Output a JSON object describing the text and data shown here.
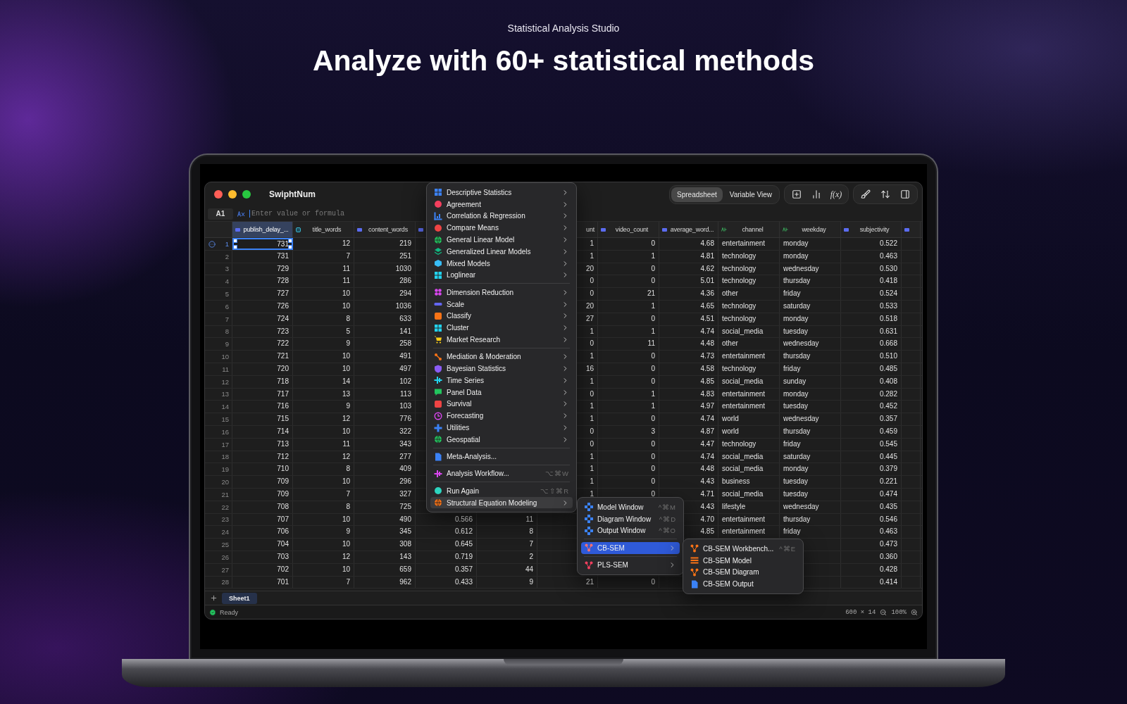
{
  "page": {
    "subtitle": "Statistical Analysis Studio",
    "headline": "Analyze with 60+ statistical methods"
  },
  "window": {
    "title": "SwiphtNum"
  },
  "view_switch": [
    {
      "label": "Spreadsheet",
      "selected": true
    },
    {
      "label": "Variable View",
      "selected": false
    }
  ],
  "toolbar": {
    "formula_button": "f(x)"
  },
  "formula_bar": {
    "cell_ref": "A1",
    "placeholder": "Enter value or formula"
  },
  "columns": [
    {
      "label": "publish_delay_...",
      "kind": "scale",
      "selected": true
    },
    {
      "label": "title_words",
      "kind": "ordinal",
      "selected": false
    },
    {
      "label": "content_words",
      "kind": "scale",
      "selected": false
    },
    {
      "kind": "scale",
      "selected": false
    },
    {},
    {
      "label": "unt",
      "clipped": true,
      "selected": false
    },
    {
      "label": "video_count",
      "kind": "scale",
      "selected": false
    },
    {
      "label": "average_word...",
      "kind": "scale",
      "selected": false
    },
    {
      "label": "channel",
      "kind": "nominal",
      "selected": false
    },
    {
      "label": "weekday",
      "kind": "nominal",
      "selected": false
    },
    {
      "label": "subjectivity",
      "kind": "scale",
      "selected": false
    },
    {
      "kind": "scale",
      "selected": false
    }
  ],
  "rows": [
    {
      "number": "1",
      "selected": true,
      "cells": [
        "731",
        "12",
        "219",
        null,
        null,
        "1",
        "0",
        "4.68",
        "entertainment",
        "monday",
        "0.522",
        null
      ]
    },
    {
      "number": "2",
      "selected": false,
      "cells": [
        "731",
        "7",
        "251",
        null,
        null,
        "1",
        "1",
        "4.81",
        "technology",
        "monday",
        "0.463",
        null
      ]
    },
    {
      "number": "3",
      "selected": false,
      "cells": [
        "729",
        "11",
        "1030",
        null,
        null,
        "20",
        "0",
        "4.62",
        "technology",
        "wednesday",
        "0.530",
        null
      ]
    },
    {
      "number": "4",
      "selected": false,
      "cells": [
        "728",
        "11",
        "286",
        null,
        null,
        "0",
        "0",
        "5.01",
        "technology",
        "thursday",
        "0.418",
        null
      ]
    },
    {
      "number": "5",
      "selected": false,
      "cells": [
        "727",
        "10",
        "294",
        null,
        null,
        "0",
        "21",
        "4.36",
        "other",
        "friday",
        "0.524",
        null
      ]
    },
    {
      "number": "6",
      "selected": false,
      "cells": [
        "726",
        "10",
        "1036",
        null,
        null,
        "20",
        "1",
        "4.65",
        "technology",
        "saturday",
        "0.533",
        null
      ]
    },
    {
      "number": "7",
      "selected": false,
      "cells": [
        "724",
        "8",
        "633",
        null,
        null,
        "27",
        "0",
        "4.51",
        "technology",
        "monday",
        "0.518",
        null
      ]
    },
    {
      "number": "8",
      "selected": false,
      "cells": [
        "723",
        "5",
        "141",
        null,
        null,
        "1",
        "1",
        "4.74",
        "social_media",
        "tuesday",
        "0.631",
        null
      ]
    },
    {
      "number": "9",
      "selected": false,
      "cells": [
        "722",
        "9",
        "258",
        null,
        null,
        "0",
        "11",
        "4.48",
        "other",
        "wednesday",
        "0.668",
        null
      ]
    },
    {
      "number": "10",
      "selected": false,
      "cells": [
        "721",
        "10",
        "491",
        null,
        null,
        "1",
        "0",
        "4.73",
        "entertainment",
        "thursday",
        "0.510",
        null
      ]
    },
    {
      "number": "11",
      "selected": false,
      "cells": [
        "720",
        "10",
        "497",
        null,
        null,
        "16",
        "0",
        "4.58",
        "technology",
        "friday",
        "0.485",
        null
      ]
    },
    {
      "number": "12",
      "selected": false,
      "cells": [
        "718",
        "14",
        "102",
        null,
        null,
        "1",
        "0",
        "4.85",
        "social_media",
        "sunday",
        "0.408",
        null
      ]
    },
    {
      "number": "13",
      "selected": false,
      "cells": [
        "717",
        "13",
        "113",
        null,
        null,
        "0",
        "1",
        "4.83",
        "entertainment",
        "monday",
        "0.282",
        null
      ]
    },
    {
      "number": "14",
      "selected": false,
      "cells": [
        "716",
        "9",
        "103",
        null,
        null,
        "1",
        "1",
        "4.97",
        "entertainment",
        "tuesday",
        "0.452",
        null
      ]
    },
    {
      "number": "15",
      "selected": false,
      "cells": [
        "715",
        "12",
        "776",
        null,
        null,
        "1",
        "0",
        "4.74",
        "world",
        "wednesday",
        "0.357",
        null
      ]
    },
    {
      "number": "16",
      "selected": false,
      "cells": [
        "714",
        "10",
        "322",
        null,
        null,
        "0",
        "3",
        "4.87",
        "world",
        "thursday",
        "0.459",
        null
      ]
    },
    {
      "number": "17",
      "selected": false,
      "cells": [
        "713",
        "11",
        "343",
        null,
        null,
        "0",
        "0",
        "4.47",
        "technology",
        "friday",
        "0.545",
        null
      ]
    },
    {
      "number": "18",
      "selected": false,
      "cells": [
        "712",
        "12",
        "277",
        null,
        null,
        "1",
        "0",
        "4.74",
        "social_media",
        "saturday",
        "0.445",
        null
      ]
    },
    {
      "number": "19",
      "selected": false,
      "cells": [
        "710",
        "8",
        "409",
        null,
        null,
        "1",
        "0",
        "4.48",
        "social_media",
        "monday",
        "0.379",
        null
      ]
    },
    {
      "number": "20",
      "selected": false,
      "cells": [
        "709",
        "10",
        "296",
        null,
        null,
        "1",
        "0",
        "4.43",
        "business",
        "tuesday",
        "0.221",
        null
      ]
    },
    {
      "number": "21",
      "selected": false,
      "cells": [
        "709",
        "7",
        "327",
        null,
        null,
        "1",
        "0",
        "4.71",
        "social_media",
        "tuesday",
        "0.474",
        null
      ]
    },
    {
      "number": "22",
      "selected": false,
      "cells": [
        "708",
        "8",
        "725",
        null,
        null,
        null,
        null,
        "4.43",
        "lifestyle",
        "wednesday",
        "0.435",
        null
      ]
    },
    {
      "number": "23",
      "selected": false,
      "cells": [
        "707",
        "10",
        "490",
        "0.566",
        "11",
        null,
        null,
        "4.70",
        "entertainment",
        "thursday",
        "0.546",
        null
      ]
    },
    {
      "number": "24",
      "selected": false,
      "cells": [
        "706",
        "9",
        "345",
        "0.612",
        "8",
        null,
        null,
        "4.85",
        "entertainment",
        "friday",
        "0.463",
        null
      ]
    },
    {
      "number": "25",
      "selected": false,
      "cells": [
        "704",
        "10",
        "308",
        "0.645",
        "7",
        null,
        null,
        null,
        null,
        null,
        "0.473",
        null
      ]
    },
    {
      "number": "26",
      "selected": false,
      "cells": [
        "703",
        "12",
        "143",
        "0.719",
        "2",
        null,
        null,
        null,
        null,
        null,
        "0.360",
        null
      ]
    },
    {
      "number": "27",
      "selected": false,
      "cells": [
        "702",
        "10",
        "659",
        "0.357",
        "44",
        null,
        null,
        null,
        null,
        null,
        "0.428",
        null
      ]
    },
    {
      "number": "28",
      "selected": false,
      "cells": [
        "701",
        "7",
        "962",
        "0.433",
        "9",
        "21",
        "0",
        null,
        null,
        null,
        "0.414",
        null
      ]
    }
  ],
  "sheets": [
    {
      "label": "Sheet1",
      "selected": true
    }
  ],
  "status_bar": {
    "text": "Ready",
    "dimensions": "600 × 14",
    "zoom": "100%"
  },
  "analysis_menu": {
    "groups": [
      [
        {
          "label": "Descriptive Statistics",
          "color": "#3b82f6",
          "submenu": true,
          "selected": false
        },
        {
          "label": "Agreement",
          "color": "#f43f5e",
          "submenu": true,
          "selected": false
        },
        {
          "label": "Correlation & Regression",
          "color": "#3b82f6",
          "submenu": true,
          "selected": false
        },
        {
          "label": "Compare Means",
          "color": "#ef4444",
          "submenu": true,
          "selected": false
        },
        {
          "label": "General Linear Model",
          "color": "#22c55e",
          "submenu": true,
          "selected": false
        },
        {
          "label": "Generalized Linear Models",
          "color": "#10b981",
          "submenu": true,
          "selected": false
        },
        {
          "label": "Mixed Models",
          "color": "#38bdf8",
          "submenu": true,
          "selected": false
        },
        {
          "label": "Loglinear",
          "color": "#22d3ee",
          "submenu": true,
          "selected": false
        }
      ],
      [
        {
          "label": "Dimension Reduction",
          "color": "#d946ef",
          "submenu": true,
          "selected": false
        },
        {
          "label": "Scale",
          "color": "#6366f1",
          "submenu": true,
          "selected": false
        },
        {
          "label": "Classify",
          "color": "#f97316",
          "submenu": true,
          "selected": false
        },
        {
          "label": "Cluster",
          "color": "#22d3ee",
          "submenu": true,
          "selected": false
        },
        {
          "label": "Market Research",
          "color": "#facc15",
          "submenu": true,
          "selected": false
        }
      ],
      [
        {
          "label": "Mediation & Moderation",
          "color": "#f97316",
          "submenu": true,
          "selected": false
        },
        {
          "label": "Bayesian Statistics",
          "color": "#8b5cf6",
          "submenu": true,
          "selected": false
        },
        {
          "label": "Time Series",
          "color": "#22d3ee",
          "submenu": true,
          "selected": false
        },
        {
          "label": "Panel Data",
          "color": "#22c55e",
          "submenu": true,
          "selected": false
        },
        {
          "label": "Survival",
          "color": "#ef4444",
          "submenu": true,
          "selected": false
        },
        {
          "label": "Forecasting",
          "color": "#d946ef",
          "submenu": true,
          "selected": false
        },
        {
          "label": "Utilities",
          "color": "#3b82f6",
          "submenu": true,
          "selected": false
        },
        {
          "label": "Geospatial",
          "color": "#22c55e",
          "submenu": true,
          "selected": false
        }
      ],
      [
        {
          "label": "Meta-Analysis...",
          "color": "#3b82f6",
          "submenu": false,
          "selected": false
        }
      ],
      [
        {
          "label": "Analysis Workflow...",
          "color": "#d946ef",
          "shortcut": "⌥⌘W",
          "submenu": false,
          "selected": false
        }
      ],
      [
        {
          "label": "Run Again",
          "color": "#2dd4bf",
          "shortcut": "⌥⇧⌘R",
          "submenu": false,
          "selected": false
        },
        {
          "label": "Structural Equation Modeling",
          "color": "#f97316",
          "submenu": true,
          "selected": true
        }
      ]
    ]
  },
  "sem_menu": {
    "groups": [
      [
        {
          "label": "Model Window",
          "color": "#3b82f6",
          "shortcut": "^⌘M",
          "submenu": false,
          "selected": false
        },
        {
          "label": "Diagram Window",
          "color": "#3b82f6",
          "shortcut": "^⌘D",
          "submenu": false,
          "selected": false
        },
        {
          "label": "Output Window",
          "color": "#3b82f6",
          "shortcut": "^⌘O",
          "submenu": false,
          "selected": false
        }
      ],
      [
        {
          "label": "CB-SEM",
          "color": "#f87171",
          "submenu": true,
          "selected": true
        }
      ],
      [
        {
          "label": "PLS-SEM",
          "color": "#f43f5e",
          "submenu": true,
          "selected": false
        }
      ]
    ]
  },
  "cbsem_menu": {
    "groups": [
      [
        {
          "label": "CB-SEM Workbench...",
          "color": "#f97316",
          "shortcut": "^⌘E",
          "submenu": false,
          "selected": false
        },
        {
          "label": "CB-SEM Model",
          "color": "#f97316",
          "submenu": false,
          "selected": false
        },
        {
          "label": "CB-SEM Diagram",
          "color": "#f97316",
          "submenu": false,
          "selected": false
        },
        {
          "label": "CB-SEM Output",
          "color": "#3b82f6",
          "submenu": false,
          "selected": false
        }
      ]
    ]
  }
}
